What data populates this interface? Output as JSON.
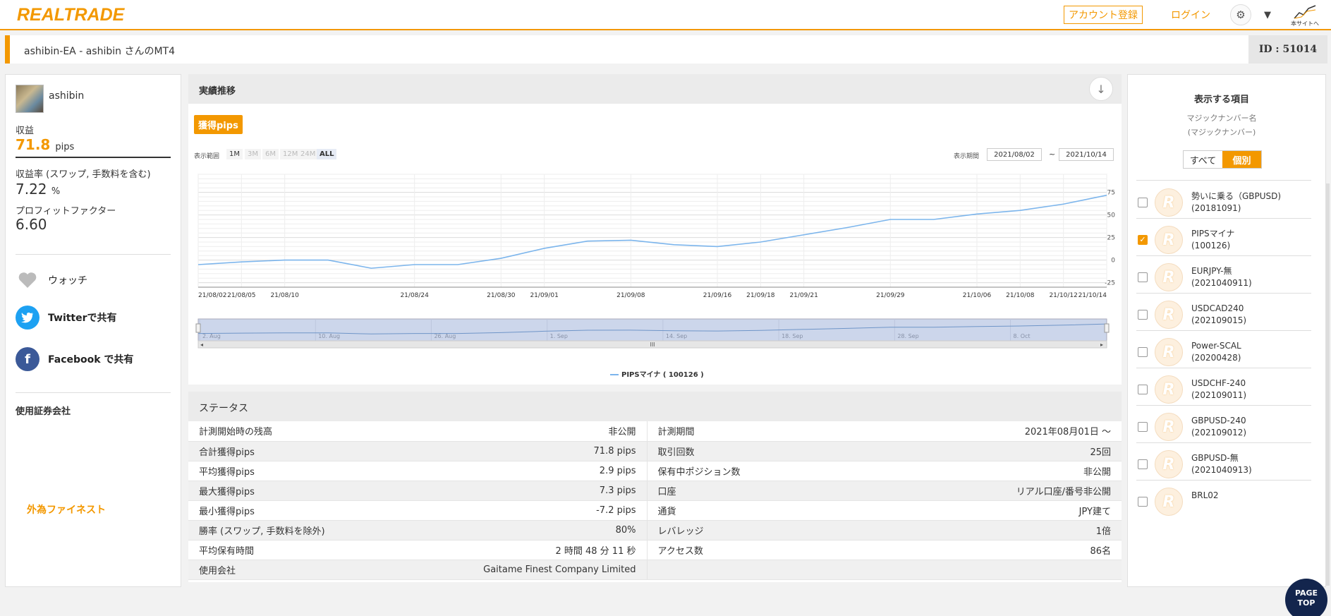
{
  "header": {
    "logo": "REALTRADE",
    "register_label": "アカウント登録",
    "login_label": "ログイン",
    "main_site_label": "本サイトへ"
  },
  "titlebar": {
    "title": "ashibin-EA - ashibin さんのMT4",
    "id_label": "ID : 51014"
  },
  "profile": {
    "username": "ashibin",
    "profit_label": "収益",
    "profit_value": "71.8",
    "profit_unit": "pips",
    "yield_label": "収益率 (スワップ, 手数料を含む)",
    "yield_value": "7.22",
    "yield_unit": "%",
    "pf_label": "プロフィットファクター",
    "pf_value": "6.60",
    "watch_label": "ウォッチ",
    "twitter_label": "Twitterで共有",
    "facebook_label": "Facebook で共有",
    "broker_label": "使用証券会社",
    "broker_name": "外為ファイネスト"
  },
  "performance": {
    "title": "実績推移",
    "badge": "獲得pips",
    "range_label": "表示範囲",
    "ranges": [
      "1M",
      "3M",
      "6M",
      "12M",
      "24M",
      "ALL"
    ],
    "period_label": "表示期間",
    "from_date": "2021/08/02",
    "to_date": "2021/10/14",
    "tilde": "~"
  },
  "chart_data": {
    "type": "line",
    "x": [
      "21/08/02",
      "21/08/05",
      "21/08/10",
      "21/08/13",
      "21/08/19",
      "21/08/24",
      "21/08/27",
      "21/08/30",
      "21/09/01",
      "21/09/03",
      "21/09/08",
      "21/09/13",
      "21/09/16",
      "21/09/18",
      "21/09/21",
      "21/09/24",
      "21/09/29",
      "21/10/01",
      "21/10/06",
      "21/10/08",
      "21/10/12",
      "21/10/14"
    ],
    "series": [
      {
        "name": "PIPSマイナ ( 100126 )",
        "values": [
          -5,
          -2,
          0,
          0,
          -9,
          -5,
          -5,
          2,
          13,
          21,
          22,
          17,
          15,
          20,
          28,
          36,
          45,
          45,
          51,
          55,
          62,
          71.8
        ]
      }
    ],
    "x_tick_labels": [
      "21/08/02",
      "21/08/05",
      "21/08/10",
      "21/08/24",
      "21/08/30",
      "21/09/01",
      "21/09/08",
      "21/09/16",
      "21/09/18",
      "21/09/21",
      "21/09/29",
      "21/10/06",
      "21/10/08",
      "21/10/12",
      "21/10/14"
    ],
    "y_ticks": [
      75,
      50,
      25,
      0,
      -25
    ],
    "ylim": [
      -30,
      95
    ],
    "navigator_labels": [
      "2. Aug",
      "10. Aug",
      "26. Aug",
      "1. Sep",
      "14. Sep",
      "18. Sep",
      "28. Sep",
      "8. Oct"
    ],
    "legend": "PIPSマイナ ( 100126 )",
    "line_color": "#7cb5ec"
  },
  "status": {
    "title": "ステータス",
    "rows": [
      {
        "k1": "計測開始時の残高",
        "v1": "非公開",
        "k2": "計測期間",
        "v2": "2021年08月01日 ～"
      },
      {
        "k1": "合計獲得pips",
        "v1": "71.8 pips",
        "k2": "取引回数",
        "v2": "25回"
      },
      {
        "k1": "平均獲得pips",
        "v1": "2.9 pips",
        "k2": "保有中ポジション数",
        "v2": "非公開"
      },
      {
        "k1": "最大獲得pips",
        "v1": "7.3 pips",
        "k2": "口座",
        "v2": "リアル口座/番号非公開"
      },
      {
        "k1": "最小獲得pips",
        "v1": "-7.2 pips",
        "k2": "通貨",
        "v2": "JPY建て"
      },
      {
        "k1": "勝率 (スワップ, 手数料を除外)",
        "v1": "80%",
        "k2": "レバレッジ",
        "v2": "1倍"
      },
      {
        "k1": "平均保有時間",
        "v1": "2 時間 48 分 11 秒",
        "k2": "アクセス数",
        "v2": "86名"
      },
      {
        "k1": "使用会社",
        "v1": "Gaitame Finest Company Limited",
        "k2": "",
        "v2": ""
      }
    ]
  },
  "sidebar": {
    "title": "表示する項目",
    "sub1": "マジックナンバー名",
    "sub2": "(マジックナンバー)",
    "toggle_all": "すべて",
    "toggle_individual": "個別",
    "items": [
      {
        "name": "勢いに乗る（GBPUSD)",
        "magic": "(20181091)",
        "checked": false
      },
      {
        "name": "PIPSマイナ",
        "magic": "(100126)",
        "checked": true
      },
      {
        "name": "EURJPY-無",
        "magic": "(2021040911)",
        "checked": false
      },
      {
        "name": "USDCAD240",
        "magic": "(202109015)",
        "checked": false
      },
      {
        "name": "Power-SCAL",
        "magic": "(20200428)",
        "checked": false
      },
      {
        "name": "USDCHF-240",
        "magic": "(202109011)",
        "checked": false
      },
      {
        "name": "GBPUSD-240",
        "magic": "(202109012)",
        "checked": false
      },
      {
        "name": "GBPUSD-無",
        "magic": "(2021040913)",
        "checked": false
      },
      {
        "name": "BRL02",
        "magic": "",
        "checked": false
      }
    ]
  },
  "pagetop": {
    "line1": "PAGE",
    "line2": "TOP"
  },
  "colors": {
    "accent": "#f39800",
    "navy": "#13254d"
  }
}
